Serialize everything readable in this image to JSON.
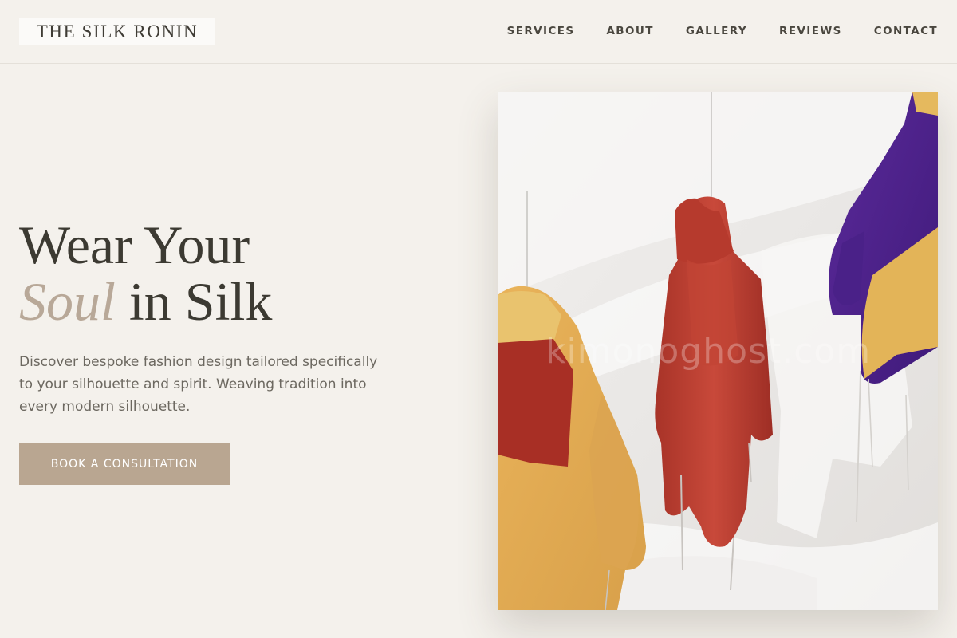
{
  "header": {
    "logo": "THE SILK RONIN",
    "nav": [
      {
        "label": "SERVICES"
      },
      {
        "label": "ABOUT"
      },
      {
        "label": "GALLERY"
      },
      {
        "label": "REVIEWS"
      },
      {
        "label": "CONTACT"
      }
    ]
  },
  "hero": {
    "title_line1": "Wear Your",
    "title_accent": "Soul",
    "title_rest": " in Silk",
    "description": "Discover bespoke fashion design tailored specifically to your silhouette and spirit. Weaving tradition into every modern silhouette.",
    "cta_label": "BOOK A CONSULTATION"
  },
  "image": {
    "watermark": "kimonoghost.com"
  },
  "colors": {
    "background": "#f4f1ec",
    "accent": "#b9a691",
    "title_accent": "#b8a898",
    "text_dark": "#3c3a32"
  }
}
